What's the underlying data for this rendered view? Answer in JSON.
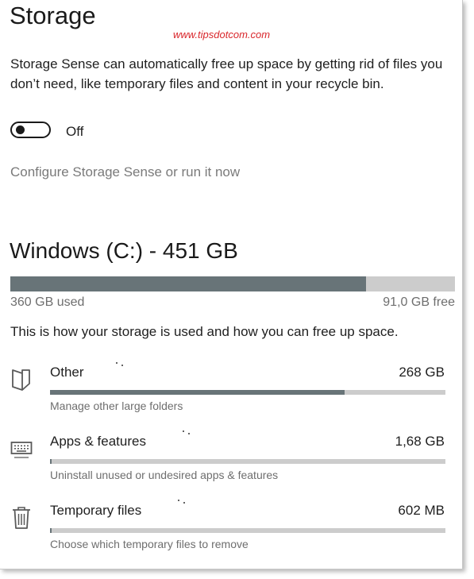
{
  "page": {
    "title": "Storage",
    "watermark": "www.tipsdotcom.com"
  },
  "storage_sense": {
    "description": "Storage Sense can automatically free up space by getting rid of files you don’t need, like temporary files and content in your recycle bin.",
    "toggle_state": "Off",
    "toggle_on": false,
    "configure_link": "Configure Storage Sense or run it now"
  },
  "drive": {
    "title": "Windows (C:) - 451 GB",
    "used_label": "360 GB used",
    "free_label": "91,0 GB free",
    "used_fraction": 0.8,
    "usage_description": "This is how your storage is used and how you can free up space."
  },
  "categories": [
    {
      "name": "Other",
      "size": "268 GB",
      "subtitle": "Manage other large folders",
      "fill_fraction": 0.744,
      "icon": "document-folder-icon"
    },
    {
      "name": "Apps & features",
      "size": "1,68 GB",
      "subtitle": "Uninstall unused or undesired apps & features",
      "fill_fraction": 0.005,
      "icon": "keyboard-icon"
    },
    {
      "name": "Temporary files",
      "size": "602 MB",
      "subtitle": "Choose which temporary files to remove",
      "fill_fraction": 0.002,
      "icon": "trash-icon"
    }
  ],
  "colors": {
    "bar_fill": "#687478",
    "bar_track": "#cccccc",
    "watermark": "#d9262b",
    "link": "#7a7a7a"
  }
}
